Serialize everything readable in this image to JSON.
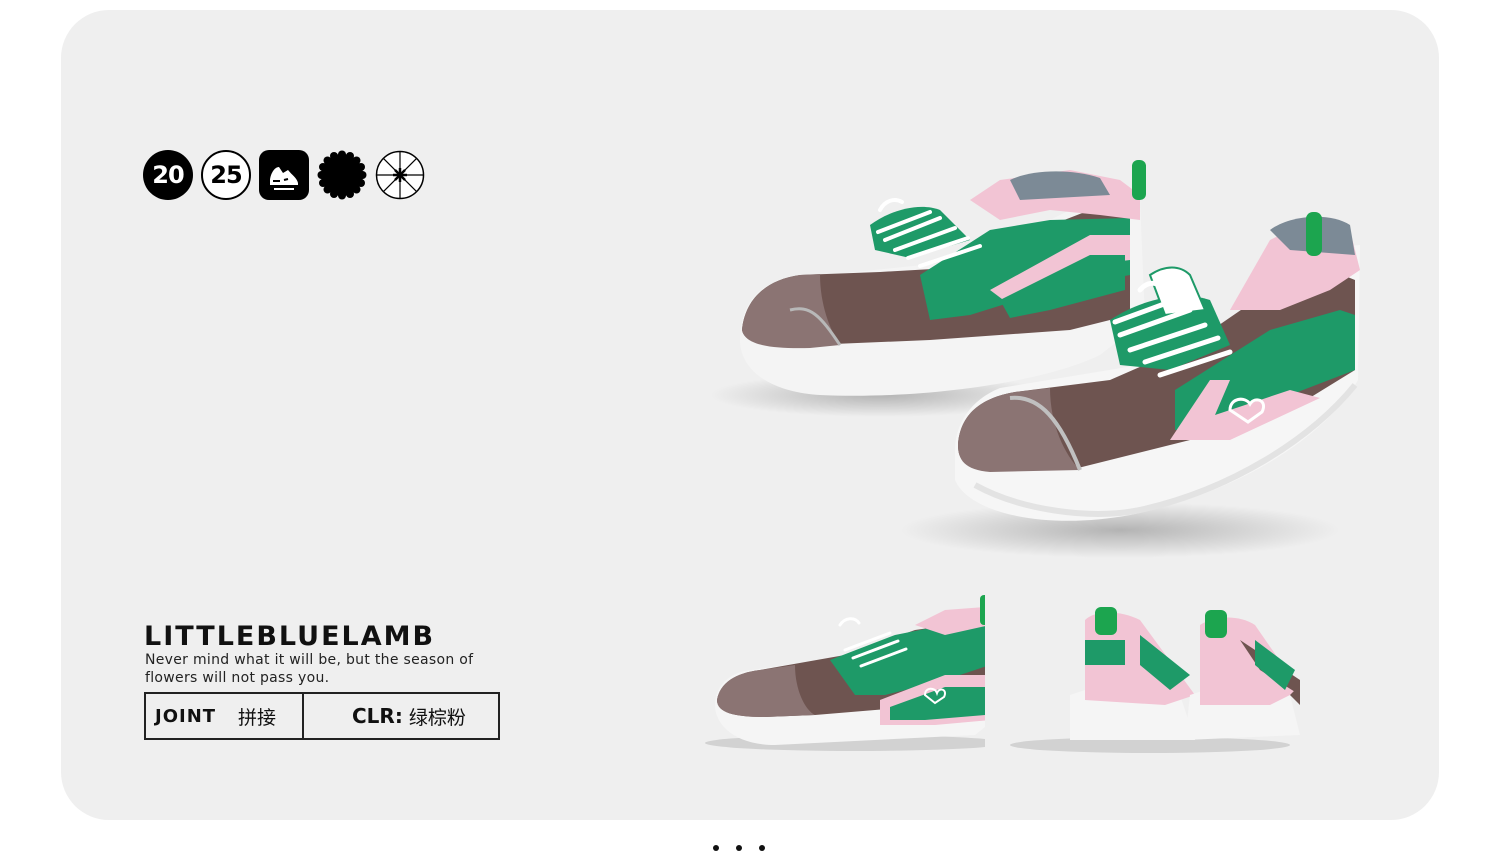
{
  "badges": {
    "year_first": "20",
    "year_second": "25",
    "icons": [
      "shoe-icon",
      "scalloped-badge-icon",
      "asterisk-circle-icon"
    ]
  },
  "brand": {
    "name": "LITTLEBLUELAMB",
    "tagline": "Never mind what it will be, but the season of flowers will not pass you."
  },
  "specs": {
    "left_key": "JOINT",
    "left_value": "拼接",
    "right_key": "CLR:",
    "right_value": "绿棕粉"
  },
  "colors": {
    "card_bg": "#efefef",
    "shoe_green": "#1e9a68",
    "shoe_brown": "#6e5450",
    "shoe_pink": "#f2c4d4",
    "sole": "#f6f6f6"
  },
  "pager": {
    "count": 3
  }
}
